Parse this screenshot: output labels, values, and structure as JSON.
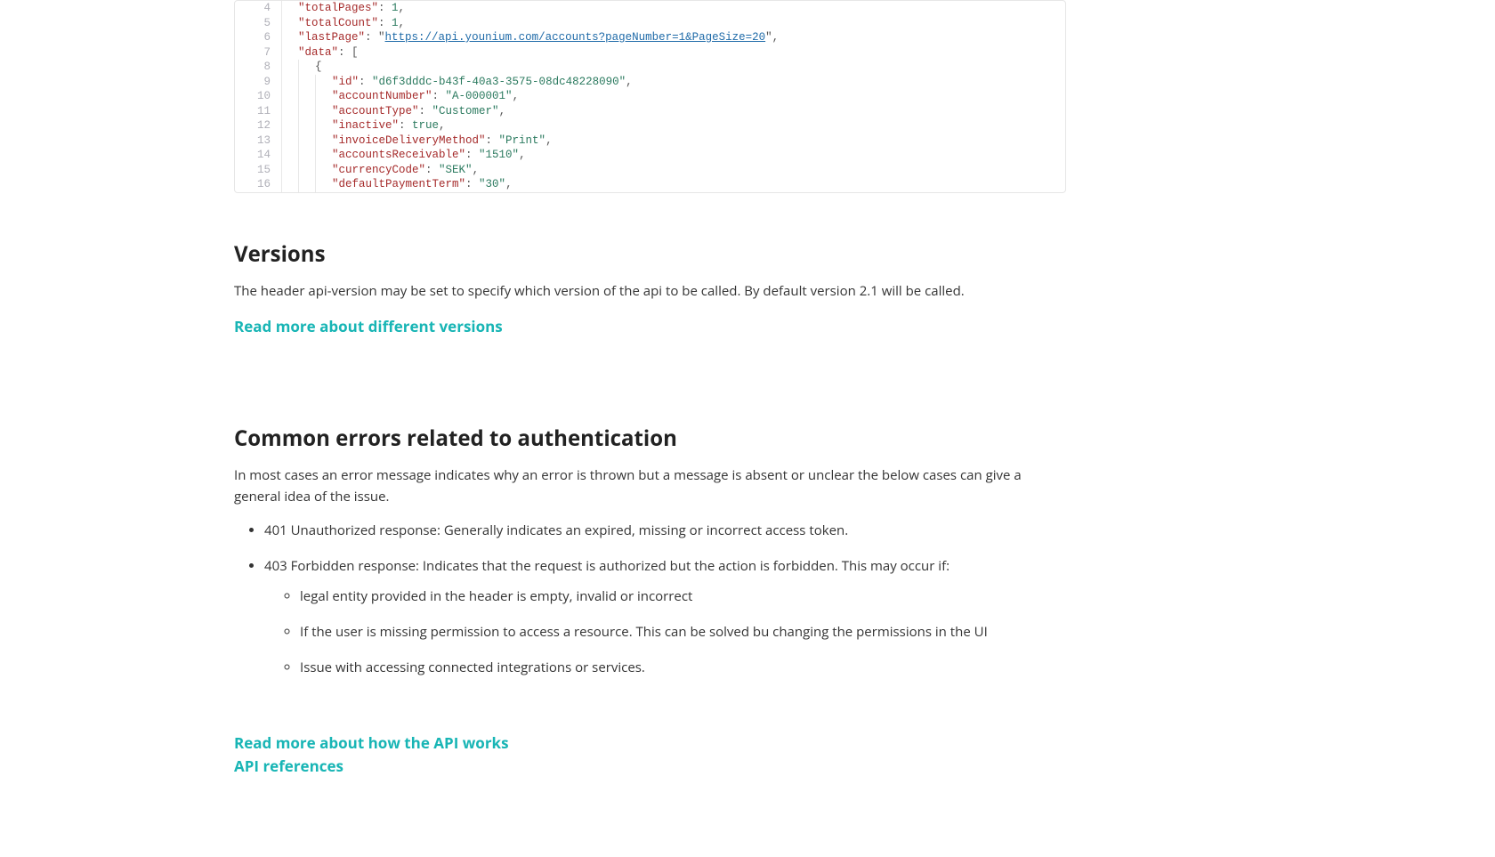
{
  "code": {
    "lines": [
      {
        "num": 4,
        "indent": 2,
        "bars": 1,
        "key": "totalPages",
        "valueType": "num",
        "value": "1",
        "trail": ","
      },
      {
        "num": 5,
        "indent": 2,
        "bars": 1,
        "key": "totalCount",
        "valueType": "num",
        "value": "1",
        "trail": ","
      },
      {
        "num": 6,
        "indent": 2,
        "bars": 1,
        "key": "lastPage",
        "valueType": "url",
        "value": "https://api.younium.com/accounts?pageNumber=1&PageSize=20",
        "trail": ","
      },
      {
        "num": 7,
        "indent": 2,
        "bars": 1,
        "key": "data",
        "valueType": "raw",
        "value": "[",
        "trail": ""
      },
      {
        "num": 8,
        "indent": 3,
        "bars": 2,
        "key": null,
        "valueType": "raw",
        "value": "{",
        "trail": ""
      },
      {
        "num": 9,
        "indent": 4,
        "bars": 3,
        "key": "id",
        "valueType": "str",
        "value": "d6f3dddc-b43f-40a3-3575-08dc48228090",
        "trail": ","
      },
      {
        "num": 10,
        "indent": 4,
        "bars": 3,
        "key": "accountNumber",
        "valueType": "str",
        "value": "A-000001",
        "trail": ","
      },
      {
        "num": 11,
        "indent": 4,
        "bars": 3,
        "key": "accountType",
        "valueType": "str",
        "value": "Customer",
        "trail": ","
      },
      {
        "num": 12,
        "indent": 4,
        "bars": 3,
        "key": "inactive",
        "valueType": "bool",
        "value": "true",
        "trail": ","
      },
      {
        "num": 13,
        "indent": 4,
        "bars": 3,
        "key": "invoiceDeliveryMethod",
        "valueType": "str",
        "value": "Print",
        "trail": ","
      },
      {
        "num": 14,
        "indent": 4,
        "bars": 3,
        "key": "accountsReceivable",
        "valueType": "str",
        "value": "1510",
        "trail": ","
      },
      {
        "num": 15,
        "indent": 4,
        "bars": 3,
        "key": "currencyCode",
        "valueType": "str",
        "value": "SEK",
        "trail": ","
      },
      {
        "num": 16,
        "indent": 4,
        "bars": 3,
        "key": "defaultPaymentTerm",
        "valueType": "str",
        "value": "30",
        "trail": ","
      }
    ]
  },
  "versions": {
    "heading": "Versions",
    "para": "The header api-version may be set to specify which version of the api to be called. By default version 2.1 will be called.",
    "link": "Read more about different versions"
  },
  "errors": {
    "heading": "Common errors related to authentication",
    "para": "In most cases an error message indicates why an error is thrown but a message is absent or unclear the below cases can give a general idea of the issue.",
    "items": [
      {
        "text": "401 Unauthorized response: Generally indicates an expired, missing or incorrect access token.",
        "sub": []
      },
      {
        "text": "403 Forbidden response: Indicates that the request is authorized but the action is forbidden. This may occur if:",
        "sub": [
          "legal entity provided in the header is empty, invalid or incorrect",
          "If the user is missing permission to access a resource. This can be solved bu changing the permissions in the UI",
          "Issue with accessing connected integrations or services."
        ]
      }
    ]
  },
  "footerLinks": {
    "apiWorks": "Read more about how the API works",
    "apiRef": "API references"
  }
}
